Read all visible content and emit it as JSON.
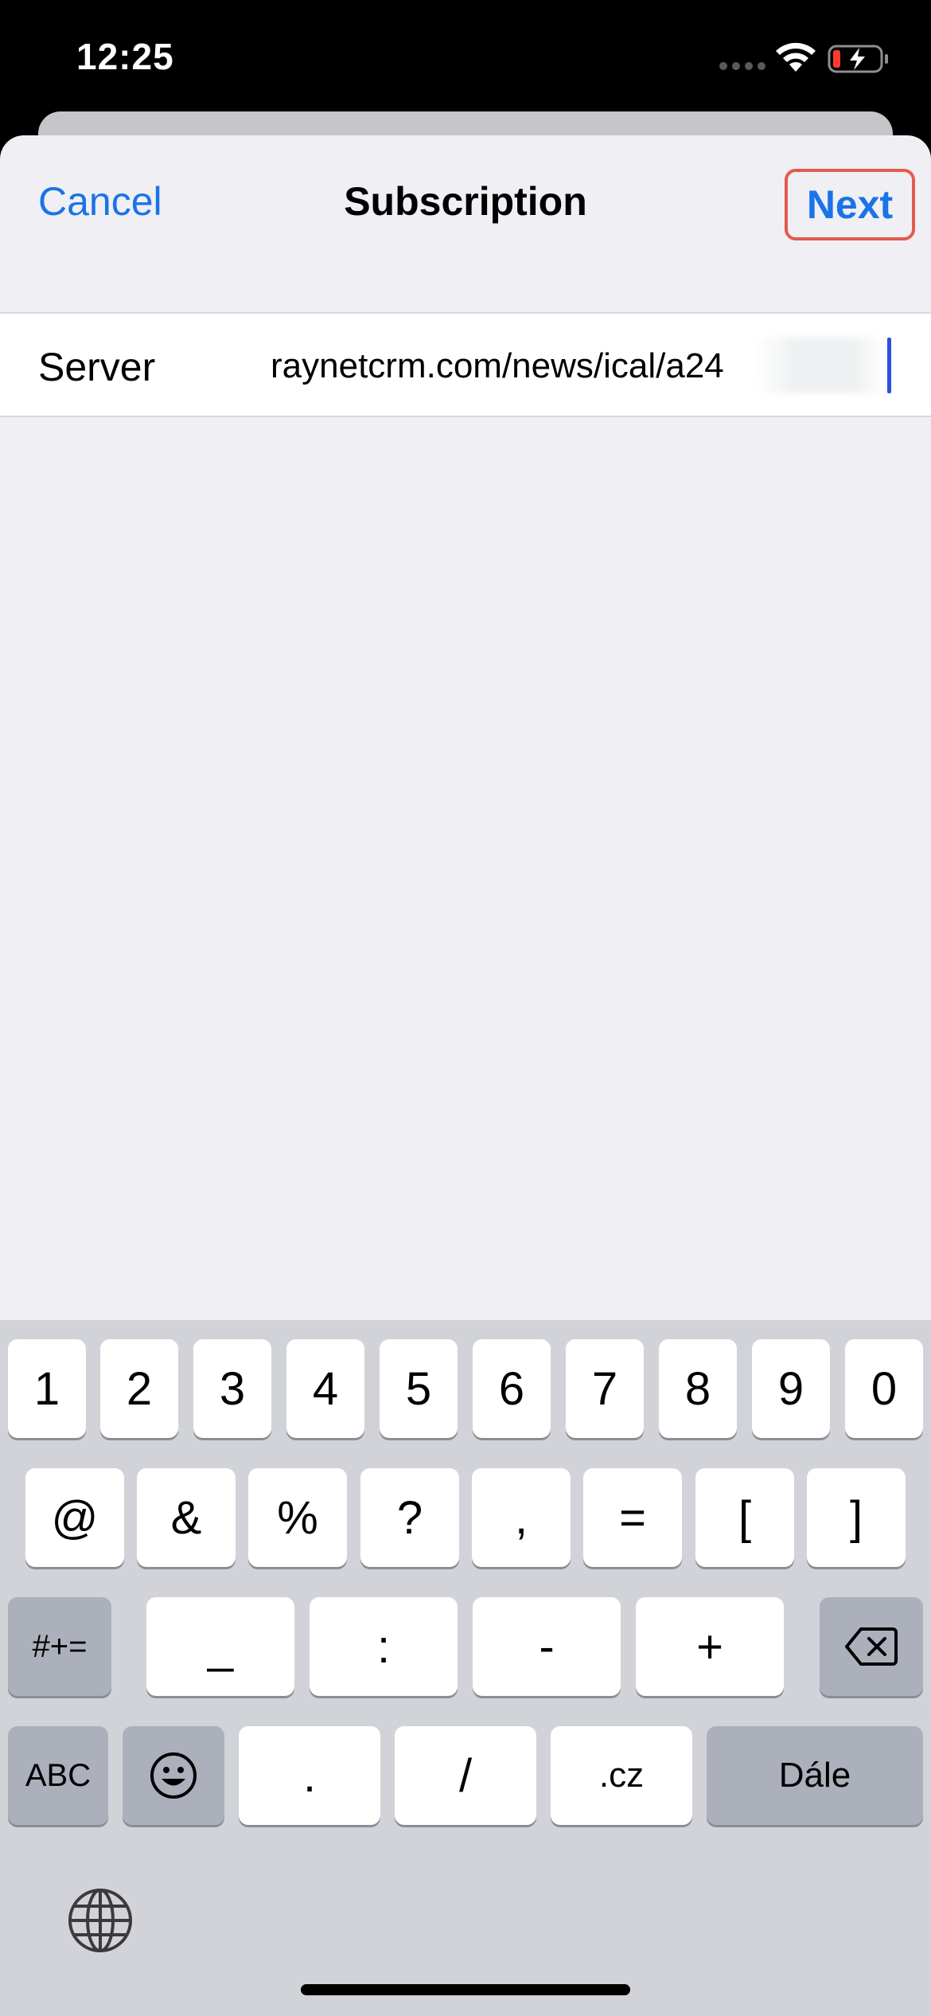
{
  "status_bar": {
    "time": "12:25"
  },
  "nav": {
    "cancel_label": "Cancel",
    "title": "Subscription",
    "next_label": "Next"
  },
  "form": {
    "server_label": "Server",
    "server_value": "raynetcrm.com/news/ical/a24"
  },
  "keyboard": {
    "row1": [
      "1",
      "2",
      "3",
      "4",
      "5",
      "6",
      "7",
      "8",
      "9",
      "0"
    ],
    "row2": [
      "@",
      "&",
      "%",
      "?",
      ",",
      "=",
      "[",
      "]"
    ],
    "row3": [
      "_",
      ":",
      "-",
      "+"
    ],
    "symbols_label": "#+=",
    "abc_label": "ABC",
    "dot_label": ".",
    "slash_label": "/",
    "domain_label": ".cz",
    "go_label": "Dále"
  },
  "colors": {
    "accent": "#1a73e8",
    "highlight_border": "#e25b4c",
    "caret": "#2d4ee0"
  }
}
